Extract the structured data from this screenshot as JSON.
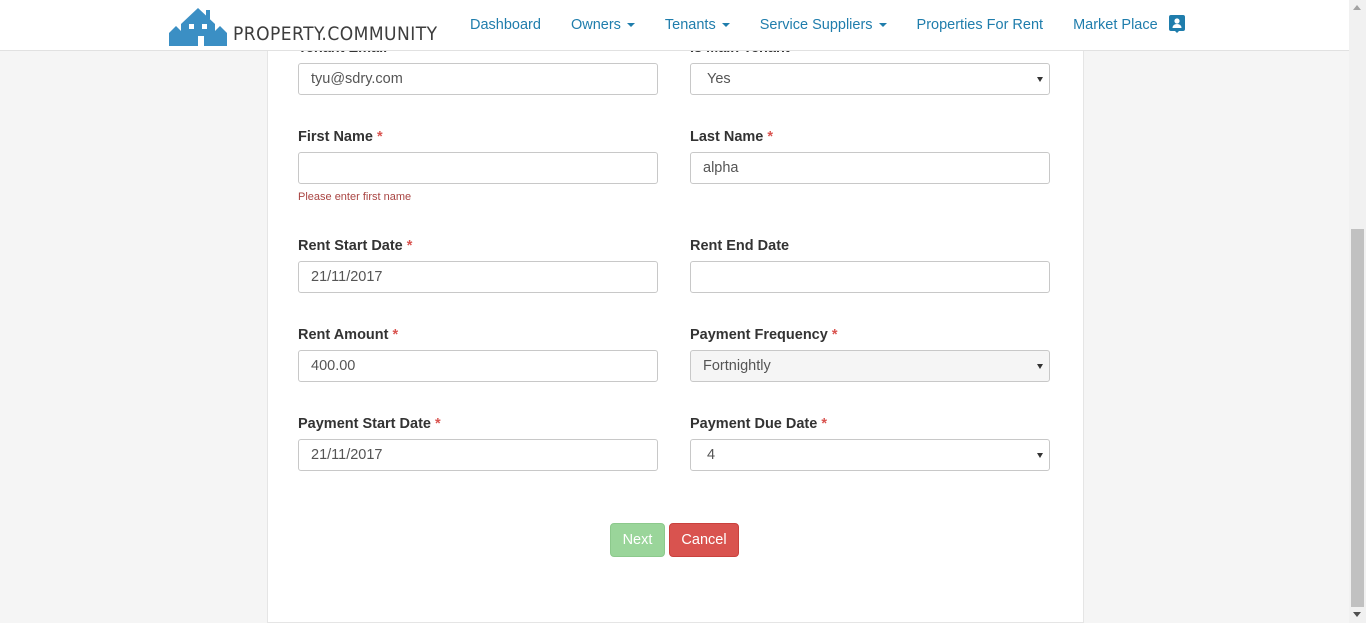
{
  "brand": {
    "name": "PROPERTY.COMMUNITY",
    "logo_icon": "house-logo-icon"
  },
  "nav": {
    "items": [
      {
        "label": "Dashboard",
        "dropdown": false
      },
      {
        "label": "Owners",
        "dropdown": true
      },
      {
        "label": "Tenants",
        "dropdown": true
      },
      {
        "label": "Service Suppliers",
        "dropdown": true
      },
      {
        "label": "Properties For Rent",
        "dropdown": false
      },
      {
        "label": "Market Place",
        "dropdown": false
      }
    ],
    "profile_icon": "contact-card-icon",
    "link_color": "#1f7dac"
  },
  "form": {
    "tenant_email": {
      "label": "Tenant Email",
      "required": "*",
      "value": "tyu@sdry.com"
    },
    "is_main_tenant": {
      "label": "Is Main Tenant",
      "required": "*",
      "value": "Yes"
    },
    "first_name": {
      "label": "First Name",
      "required": "*",
      "value": "",
      "error": "Please enter first name"
    },
    "last_name": {
      "label": "Last Name",
      "required": "*",
      "value": "alpha"
    },
    "rent_start_date": {
      "label": "Rent Start Date",
      "required": "*",
      "value": "21/11/2017"
    },
    "rent_end_date": {
      "label": "Rent End Date",
      "value": ""
    },
    "rent_amount": {
      "label": "Rent Amount",
      "required": "*",
      "value": "400.00"
    },
    "payment_frequency": {
      "label": "Payment Frequency",
      "required": "*",
      "value": "Fortnightly"
    },
    "payment_start_date": {
      "label": "Payment Start Date",
      "required": "*",
      "value": "21/11/2017"
    },
    "payment_due_date": {
      "label": "Payment Due Date",
      "required": "*",
      "value": "4"
    }
  },
  "buttons": {
    "next": "Next",
    "cancel": "Cancel"
  },
  "colors": {
    "required": "#d9534f",
    "error": "#a94442",
    "next": "#9ad59a",
    "cancel": "#d9534f"
  }
}
